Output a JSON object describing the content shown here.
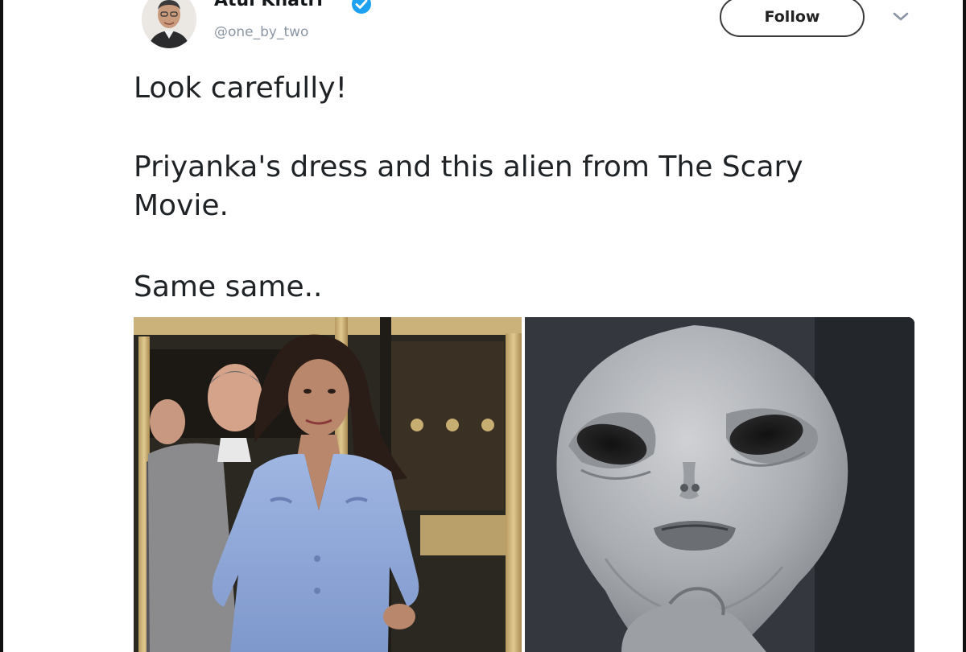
{
  "author": {
    "name": "Atul Khatri",
    "handle": "@one_by_two",
    "verified": true,
    "avatar_icon": "user-avatar-photo"
  },
  "actions": {
    "follow_label": "Follow",
    "menu_icon": "chevron-down-icon"
  },
  "tweet": {
    "line1": "Look carefully!",
    "line2": "Priyanka's dress and this alien from The Scary",
    "line3": "Movie.",
    "line4": "Same same.."
  },
  "colors": {
    "verified_blue": "#1da1f2",
    "text": "#202326",
    "handle_gray": "#8a96a3"
  }
}
